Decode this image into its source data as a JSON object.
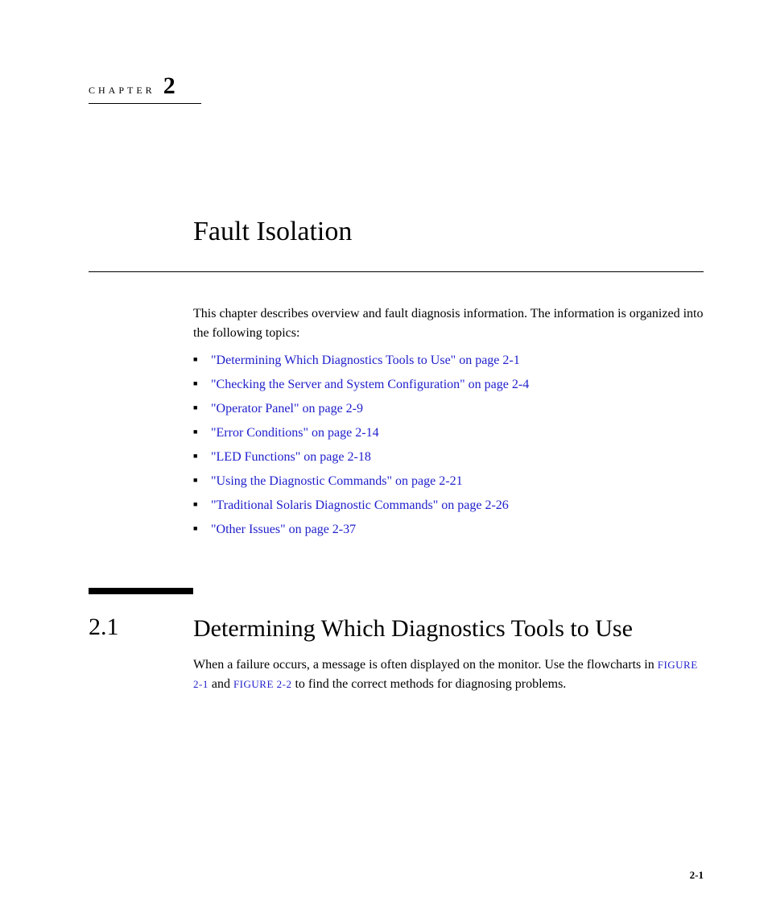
{
  "chapter": {
    "label": "CHAPTER",
    "number": "2",
    "title": "Fault Isolation"
  },
  "intro": {
    "text": "This chapter describes overview and fault diagnosis information. The information is organized into the following topics:"
  },
  "topics": [
    "\"Determining Which Diagnostics Tools to Use\" on page 2-1",
    "\"Checking the Server and System Configuration\" on page 2-4",
    "\"Operator Panel\" on page 2-9",
    "\"Error Conditions\" on page 2-14",
    "\"LED Functions\" on page 2-18",
    "\"Using the Diagnostic Commands\" on page 2-21",
    "\"Traditional Solaris Diagnostic Commands\" on page 2-26",
    "\"Other Issues\" on page 2-37"
  ],
  "section": {
    "number": "2.1",
    "title": "Determining Which Diagnostics Tools to Use",
    "body_pre": "When a failure occurs, a message is often displayed on the monitor. Use the flowcharts in ",
    "figref1": "FIGURE 2-1",
    "body_mid": " and ",
    "figref2": "FIGURE 2-2",
    "body_post": " to find the correct methods for diagnosing problems."
  },
  "page_number": "2-1"
}
